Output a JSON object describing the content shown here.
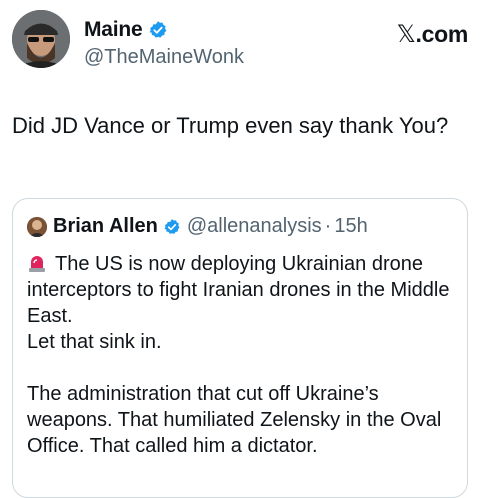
{
  "author": {
    "name": "Maine",
    "handle": "@TheMaineWonk",
    "verified": true
  },
  "brand": {
    "x_glyph": "𝕏",
    "suffix": ".com"
  },
  "tweet": {
    "text": "Did JD Vance or Trump even say thank You?"
  },
  "quoted_tweet": {
    "author_name": "Brian Allen",
    "handle": "@allenanalysis",
    "separator": "·",
    "time": "15h",
    "verified": true,
    "lead_icon": "police-siren-icon",
    "line1": "The US is now deploying Ukrainian drone interceptors to fight Iranian drones in the Middle East.",
    "line2": "Let that sink in.",
    "line3": "The administration that cut off Ukraine’s weapons. That humiliated Zelensky in the Oval Office. That called him a dictator."
  },
  "colors": {
    "text": "#0f1419",
    "secondary": "#536471",
    "verified_blue": "#1d9bf0",
    "border": "#cfd9de"
  }
}
